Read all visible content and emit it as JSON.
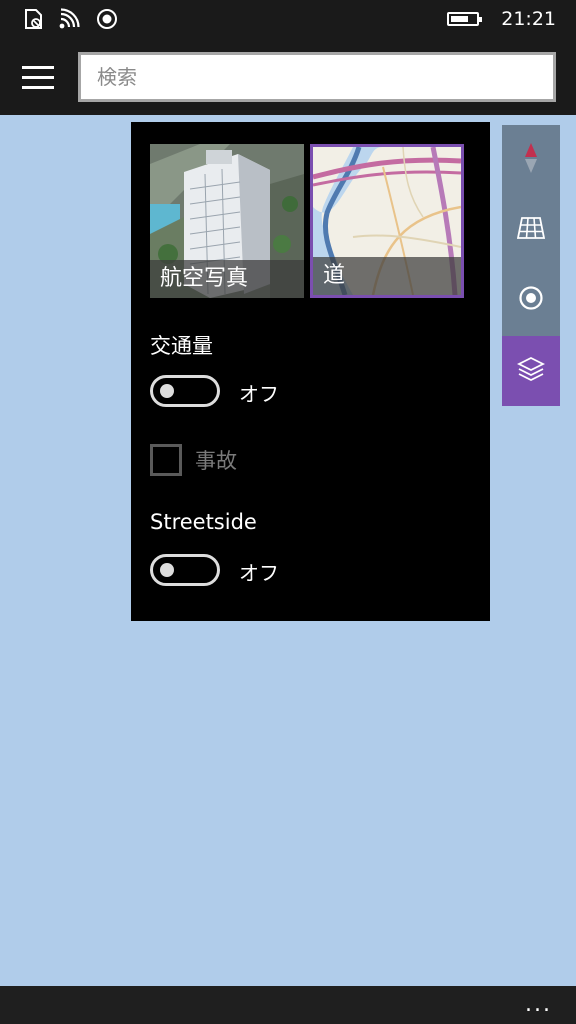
{
  "status_bar": {
    "time": "21:21",
    "battery_level": 0.7,
    "icons": [
      "sim-icon",
      "wifi-icon",
      "location-icon"
    ]
  },
  "app_bar": {
    "search_placeholder": "検索"
  },
  "layers_panel": {
    "tiles": [
      {
        "label": "航空写真",
        "selected": false
      },
      {
        "label": "道",
        "selected": true
      }
    ],
    "traffic": {
      "title": "交通量",
      "state_label": "オフ",
      "on": false
    },
    "accidents": {
      "label": "事故",
      "checked": false,
      "enabled": false
    },
    "streetside": {
      "title": "Streetside",
      "state_label": "オフ",
      "on": false
    }
  },
  "map_controls": {
    "items": [
      "compass-icon",
      "3d-grid-icon",
      "my-location-icon",
      "layers-icon"
    ],
    "active": "layers-icon",
    "accent": "#7b4fb0"
  },
  "bottom_bar": {
    "more_label": "..."
  },
  "colors": {
    "map_background": "#b0ccea",
    "chrome": "#1a1a1a",
    "accent": "#7b4fb0",
    "rail": "#6b7f93"
  }
}
